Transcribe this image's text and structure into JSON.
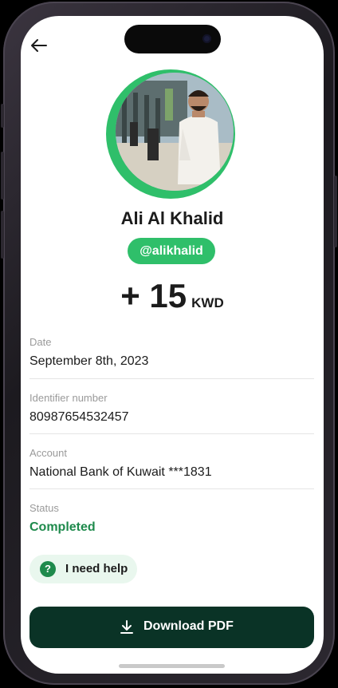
{
  "profile": {
    "name": "Ali Al Khalid",
    "handle": "@alikhalid"
  },
  "transaction": {
    "amount": "+ 15",
    "currency": "KWD"
  },
  "details": [
    {
      "label": "Date",
      "value": "September 8th, 2023"
    },
    {
      "label": "Identifier number",
      "value": "80987654532457"
    },
    {
      "label": "Account",
      "value": "National Bank of Kuwait ***1831"
    },
    {
      "label": "Status",
      "value": "Completed"
    }
  ],
  "actions": {
    "help_label": "I need help",
    "help_icon": "?",
    "download_label": "Download PDF"
  },
  "icons": {
    "back": "arrow-left-icon",
    "help": "question-circle-icon",
    "download": "download-icon"
  },
  "colors": {
    "accent": "#2fbf6a",
    "status_completed": "#1e8a4c",
    "primary_button": "#0a3326"
  }
}
